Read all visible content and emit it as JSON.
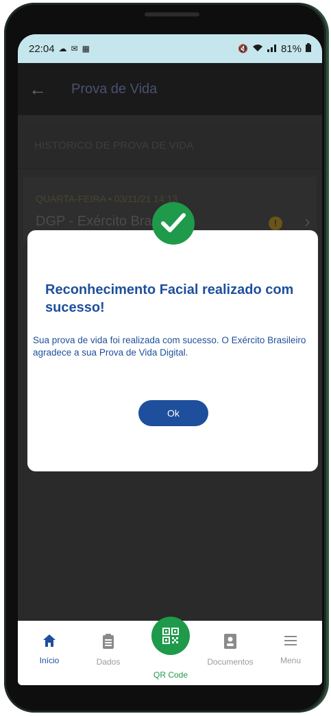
{
  "status_bar": {
    "time": "22:04",
    "left_icons": [
      "cloud-icon",
      "message-icon",
      "calendar-icon"
    ],
    "right_icons": [
      "mute-icon",
      "wifi-icon",
      "signal-icon"
    ],
    "battery": "81%"
  },
  "app_bar": {
    "title": "Prova de Vida"
  },
  "history": {
    "section_title": "HISTÓRICO DE PROVA DE VIDA",
    "date": "QUARTA-FEIRA • 03/11/21 14:13",
    "org": "DGP - Exército Bra"
  },
  "dialog": {
    "title": "Reconhecimento Facial realizado com sucesso!",
    "message": "Sua prova de vida foi realizada com sucesso. O Exército Brasileiro agradece a sua Prova de Vida Digital.",
    "ok_label": "Ok"
  },
  "bottom_nav": {
    "items": [
      {
        "label": "Início",
        "icon": "home-icon"
      },
      {
        "label": "Dados",
        "icon": "clipboard-icon"
      },
      {
        "label": "QR Code",
        "icon": "qr-code-icon"
      },
      {
        "label": "Documentos",
        "icon": "id-card-icon"
      },
      {
        "label": "Menu",
        "icon": "menu-icon"
      }
    ]
  },
  "colors": {
    "primary": "#1e4f9c",
    "success": "#1e9a4a",
    "status_bar_bg": "#c5e6ec"
  }
}
